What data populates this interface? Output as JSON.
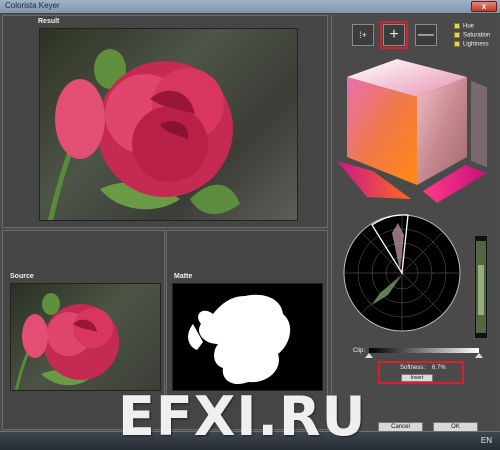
{
  "window": {
    "title": "Colorista Keyer",
    "close_label": "x"
  },
  "panels": {
    "result_label": "Result",
    "source_label": "Source",
    "matte_label": "Matte"
  },
  "toolbar": {
    "sample_icon": "sample-picker-icon",
    "add_icon": "plus-icon",
    "add_label": "+",
    "subtract_icon": "minus-icon",
    "subtract_label": "—"
  },
  "checkboxes": [
    {
      "label": "Hue",
      "checked": true
    },
    {
      "label": "Saturation",
      "checked": true
    },
    {
      "label": "Lightness",
      "checked": true
    }
  ],
  "controls": {
    "clip_label": "Clip:",
    "softness_label": "Softness:",
    "softness_value": "6.7%",
    "invert_label": "Invert",
    "cancel_label": "Cancel",
    "ok_label": "OK"
  },
  "taskbar": {
    "language": "EN"
  },
  "watermark": "EFXI.RU",
  "colors": {
    "highlight": "#d8202a",
    "check": "#e8d65a",
    "rose": "#d8365a"
  }
}
